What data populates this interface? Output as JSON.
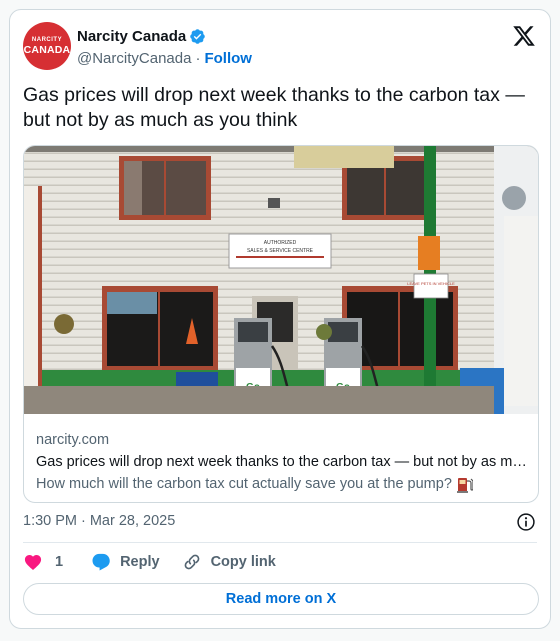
{
  "author": {
    "avatar_line1": "NARCITY",
    "avatar_line2": "CANADA",
    "display_name": "Narcity Canada",
    "handle": "@NarcityCanada",
    "separator": "·",
    "follow_label": "Follow",
    "verified_color": "#1d9bf0",
    "avatar_color": "#d62f33"
  },
  "tweet": {
    "text": "Gas prices will drop next week thanks to the carbon tax — but not by as much as you think",
    "time": "1:30 PM",
    "date_separator": "·",
    "date": "Mar 28, 2025"
  },
  "link_card": {
    "domain": "narcity.com",
    "title": "Gas prices will drop next week thanks to the carbon tax — but not by as much as you think",
    "description": "How much will the carbon tax cut actually save you at the pump?",
    "image_sign_lines": [
      "AUTHORIZED",
      "SALES & SERVICE CENTRE"
    ],
    "image_small_sign": "LEAVE PETS IN VEHICLE",
    "image_pump_brand": "Go"
  },
  "actions": {
    "like_count": "1",
    "reply_label": "Reply",
    "copy_link_label": "Copy link",
    "like_color": "#f91880",
    "reply_color": "#1d9bf0"
  },
  "footer": {
    "read_more_label": "Read more on X"
  },
  "colors": {
    "link_blue": "#006fd6",
    "muted": "#536471",
    "border": "#cfd9de"
  }
}
